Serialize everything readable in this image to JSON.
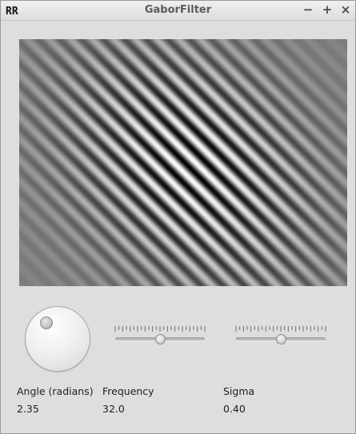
{
  "window": {
    "title": "GaborFilter",
    "icon": "RR",
    "buttons": {
      "minimize": "−",
      "maximize": "+",
      "close": "×"
    }
  },
  "controls": {
    "angle": {
      "label": "Angle (radians)",
      "value": "2.35",
      "dial_fraction": 0.37
    },
    "frequency": {
      "label": "Frequency",
      "value": "32.0",
      "slider_fraction": 0.5
    },
    "sigma": {
      "label": "Sigma",
      "value": "0.40",
      "slider_fraction": 0.5
    }
  },
  "colors": {
    "background": "#dedede",
    "filter_mid_gray": "#808080"
  }
}
